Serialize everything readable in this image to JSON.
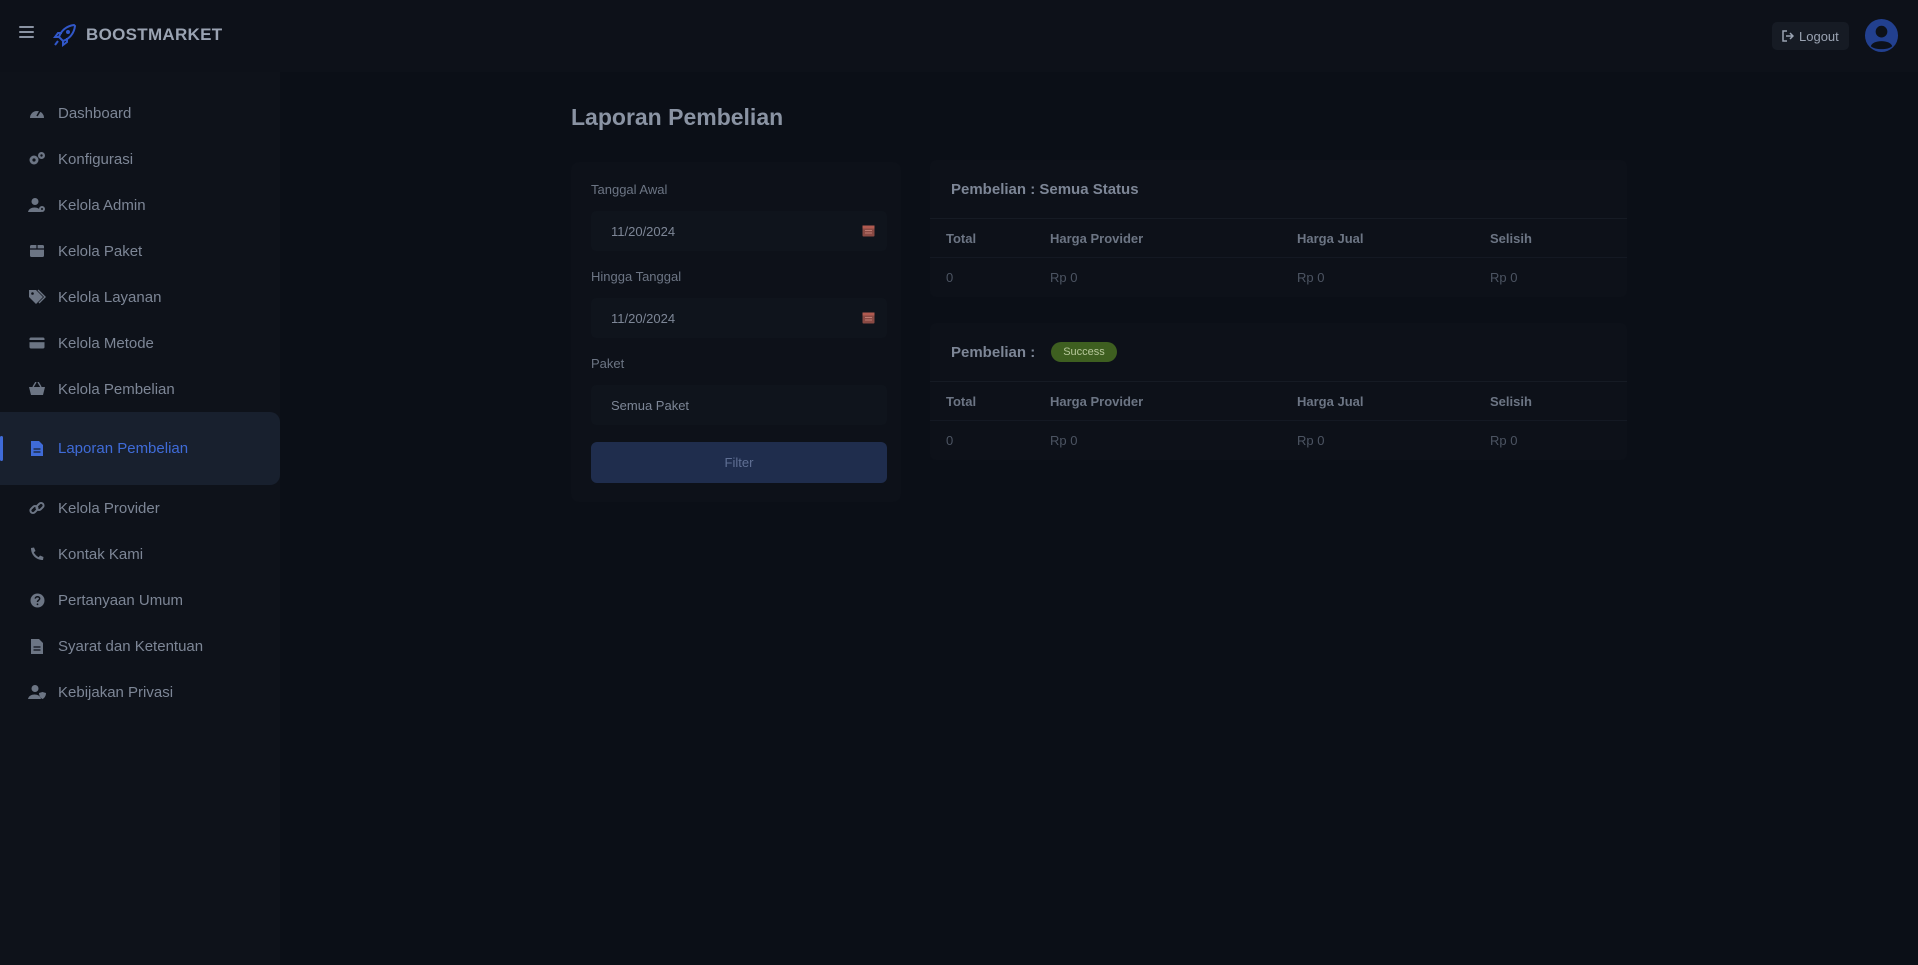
{
  "app": {
    "brand": "BOOSTMARKET",
    "logout_label": "Logout"
  },
  "sidebar": {
    "items": [
      {
        "label": "Dashboard",
        "icon": "dashboard-icon"
      },
      {
        "label": "Konfigurasi",
        "icon": "gears-icon"
      },
      {
        "label": "Kelola Admin",
        "icon": "user-gear-icon"
      },
      {
        "label": "Kelola Paket",
        "icon": "box-icon"
      },
      {
        "label": "Kelola Layanan",
        "icon": "tags-icon"
      },
      {
        "label": "Kelola Metode",
        "icon": "credit-card-icon"
      },
      {
        "label": "Kelola Pembelian",
        "icon": "basket-icon"
      },
      {
        "label": "Laporan Pembelian",
        "icon": "file-icon"
      },
      {
        "label": "Kelola Provider",
        "icon": "link-icon"
      },
      {
        "label": "Kontak Kami",
        "icon": "phone-icon"
      },
      {
        "label": "Pertanyaan Umum",
        "icon": "question-icon"
      },
      {
        "label": "Syarat dan Ketentuan",
        "icon": "document-icon"
      },
      {
        "label": "Kebijakan Privasi",
        "icon": "user-shield-icon"
      }
    ],
    "active_index": 7
  },
  "page": {
    "title": "Laporan Pembelian"
  },
  "filter": {
    "start_label": "Tanggal Awal",
    "start_value": "11/20/2024",
    "end_label": "Hingga Tanggal",
    "end_value": "11/20/2024",
    "package_label": "Paket",
    "package_value": "Semua Paket",
    "button_label": "Filter"
  },
  "tables": [
    {
      "title": "Pembelian : Semua Status",
      "badge": "",
      "headers": [
        "Total",
        "Harga Provider",
        "Harga Jual",
        "Selisih"
      ],
      "row": [
        "0",
        "Rp 0",
        "Rp 0",
        "Rp 0"
      ]
    },
    {
      "title": "Pembelian :",
      "badge": "Success",
      "headers": [
        "Total",
        "Harga Provider",
        "Harga Jual",
        "Selisih"
      ],
      "row": [
        "0",
        "Rp 0",
        "Rp 0",
        "Rp 0"
      ]
    }
  ],
  "colors": {
    "accent": "#3f6bd8",
    "success_badge": "#3e5f20"
  }
}
